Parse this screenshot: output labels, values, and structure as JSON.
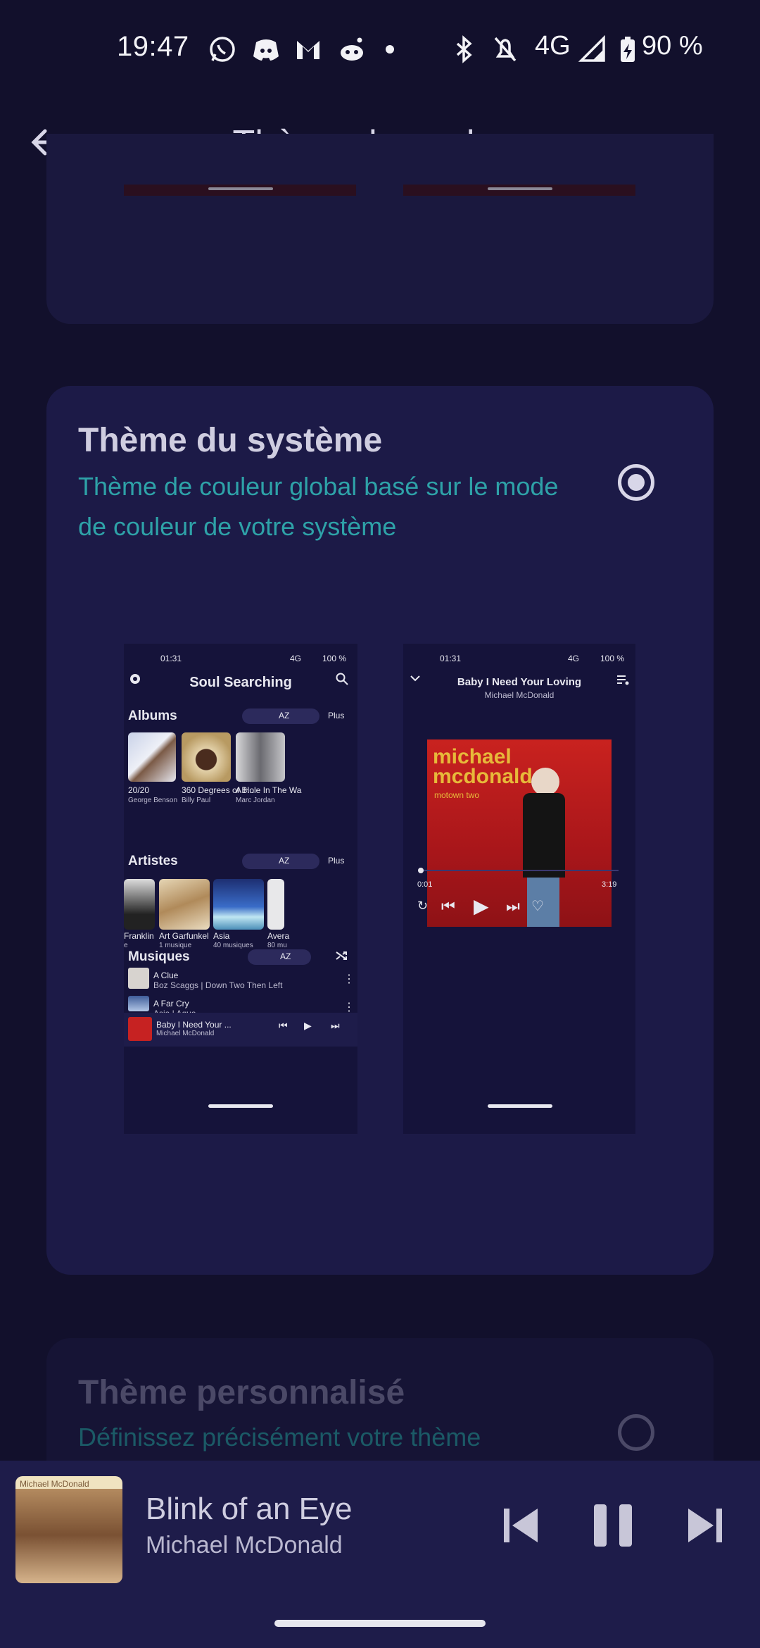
{
  "status_bar": {
    "time": "19:47",
    "network": "4G",
    "battery": "90 %",
    "icons": [
      "whatsapp-icon",
      "discord-icon",
      "gmail-icon",
      "reddit-icon",
      "dot-icon",
      "bluetooth-icon",
      "bell-off-icon",
      "signal-icon",
      "battery-charging-icon"
    ]
  },
  "app_bar": {
    "title": "Thème de couleur",
    "back_icon": "arrow-back-icon"
  },
  "system_theme": {
    "title": "Thème du système",
    "subtitle": "Thème de couleur global basé sur le mode de couleur de votre système",
    "selected": true
  },
  "custom_theme": {
    "title": "Thème personnalisé",
    "subtitle": "Définissez précisément votre thème",
    "selected": false
  },
  "preview_library": {
    "time": "01:31",
    "status_right": "4G",
    "battery": "100 %",
    "title": "Soul Searching",
    "albums_label": "Albums",
    "more": "Plus",
    "az": "AZ",
    "albums": [
      {
        "title": "20/20",
        "artist": "George Benson"
      },
      {
        "title": "360 Degrees of B...",
        "artist": "Billy Paul"
      },
      {
        "title": "A Hole In The Wa",
        "artist": "Marc Jordan"
      }
    ],
    "artists_label": "Artistes",
    "artists": [
      {
        "name": "Franklin",
        "count": "e"
      },
      {
        "name": "Art Garfunkel",
        "count": "1 musique"
      },
      {
        "name": "Asia",
        "count": "40 musiques"
      },
      {
        "name": "Avera",
        "count": "80 mu"
      }
    ],
    "songs_label": "Musiques",
    "songs": [
      {
        "title": "A Clue",
        "meta": "Boz Scaggs | Down Two Then Left"
      },
      {
        "title": "A Far Cry",
        "meta": "Asia | Aqua"
      }
    ],
    "now_playing": {
      "title": "Baby I Need Your ...",
      "artist": "Michael McDonald"
    }
  },
  "preview_player": {
    "time": "01:31",
    "status_right": "4G",
    "battery": "100 %",
    "title": "Baby I Need Your Loving",
    "artist": "Michael McDonald",
    "cover_text_1": "michael",
    "cover_text_2": "mcdonald",
    "cover_text_3": "motown two",
    "elapsed": "0:01",
    "duration": "3:19",
    "progress": 0.005
  },
  "mini_player": {
    "title": "Blink of an Eye",
    "artist": "Michael McDonald",
    "cover_text": "Michael McDonald",
    "controls": [
      "skip-previous-icon",
      "pause-icon",
      "skip-next-icon"
    ]
  },
  "colors": {
    "background": "#12102c",
    "card": "#1c1a47",
    "accent_subtitle": "#2ea2a8",
    "text": "#d8d6e8"
  }
}
